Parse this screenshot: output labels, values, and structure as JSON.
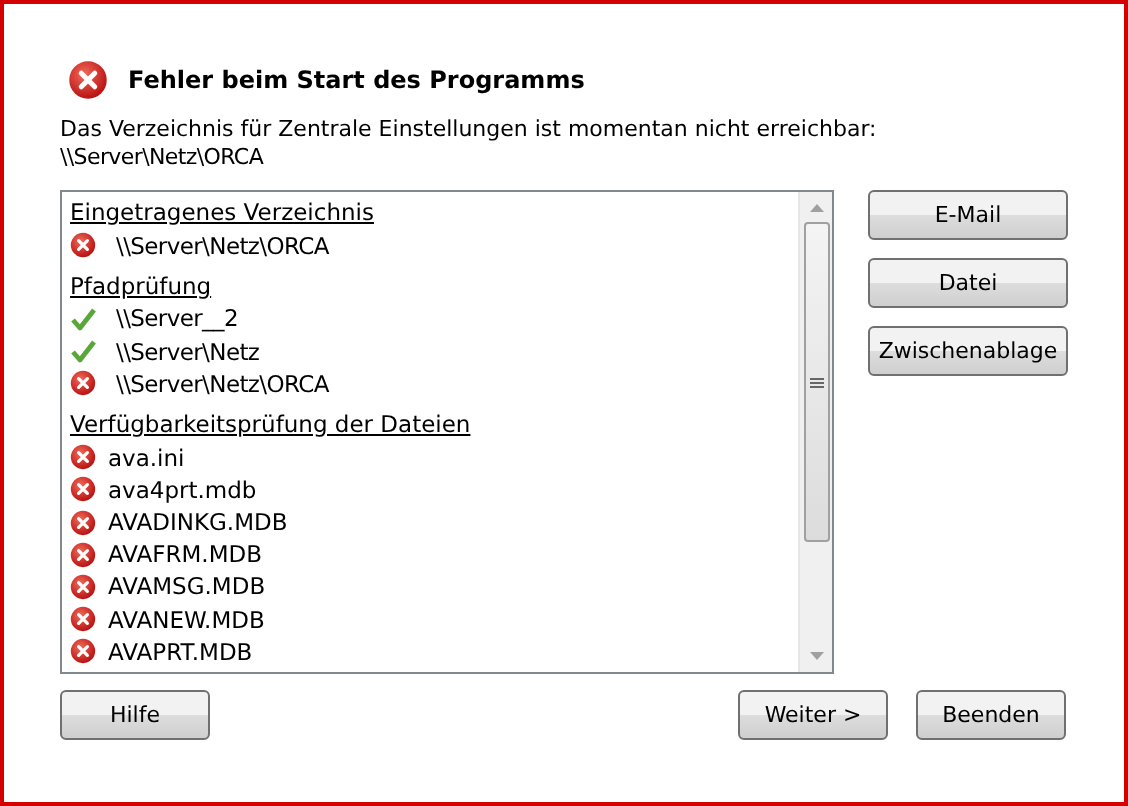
{
  "title": "Fehler beim Start des Programms",
  "message": "Das Verzeichnis für Zentrale Einstellungen ist momentan nicht erreichbar:",
  "path": "\\\\Server\\Netz\\ORCA",
  "groups": [
    {
      "heading": "Eingetragenes Verzeichnis",
      "items": [
        {
          "text": "\\\\Server\\Netz\\ORCA",
          "kind": "error"
        }
      ]
    },
    {
      "heading": "Pfadprüfung",
      "items": [
        {
          "text": "\\\\Server__2",
          "kind": "ok"
        },
        {
          "text": "\\\\Server\\Netz",
          "kind": "ok"
        },
        {
          "text": "\\\\Server\\Netz\\ORCA",
          "kind": "error"
        }
      ]
    },
    {
      "heading": "Verfügbarkeitsprüfung der Dateien",
      "items": [
        {
          "text": "ava.ini",
          "kind": "error"
        },
        {
          "text": "ava4prt.mdb",
          "kind": "error"
        },
        {
          "text": "AVADINKG.MDB",
          "kind": "error"
        },
        {
          "text": "AVAFRM.MDB",
          "kind": "error"
        },
        {
          "text": "AVAMSG.MDB",
          "kind": "error"
        },
        {
          "text": "AVANEW.MDB",
          "kind": "error"
        },
        {
          "text": "AVAPRT.MDB",
          "kind": "error"
        }
      ]
    }
  ],
  "side_buttons": [
    "E-Mail",
    "Datei",
    "Zwischenablage"
  ],
  "help_button": "Hilfe",
  "footer_buttons": [
    "Weiter >",
    "Beenden"
  ]
}
